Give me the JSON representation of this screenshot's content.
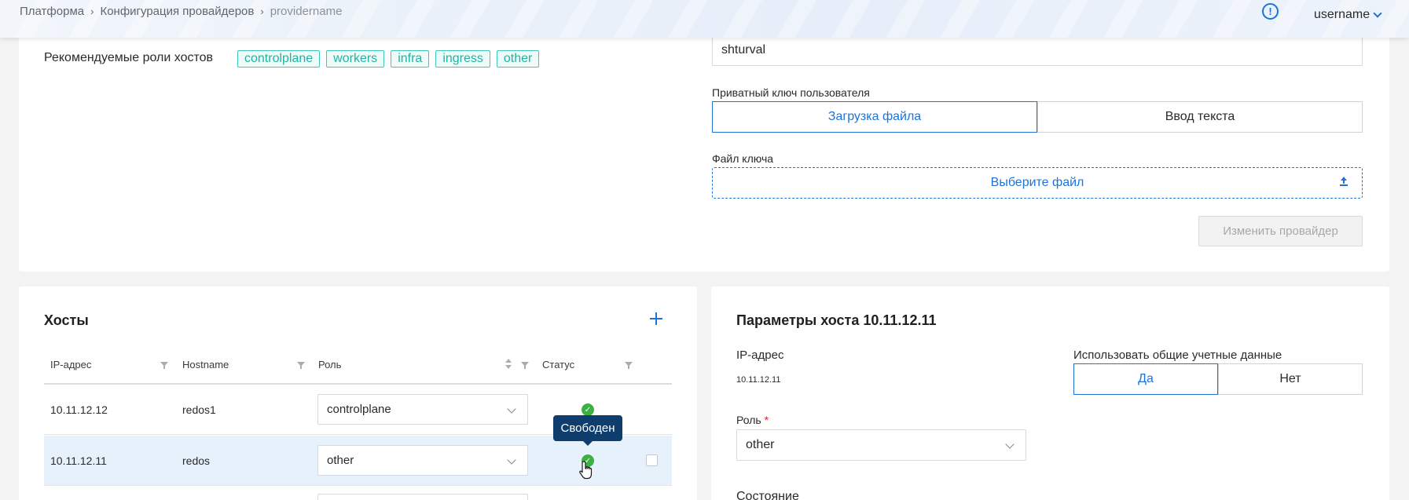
{
  "header": {
    "breadcrumb": [
      "Платформа",
      "Конфигурация провайдеров",
      "providername"
    ],
    "username": "username"
  },
  "provider": {
    "roles_label": "Рекомендуемые роли хостов",
    "roles": [
      "controlplane",
      "workers",
      "infra",
      "ingress",
      "other"
    ],
    "user_value": "shturval",
    "private_key_label": "Приватный ключ пользователя",
    "key_modes": [
      "Загрузка файла",
      "Ввод текста"
    ],
    "key_file_label": "Файл ключа",
    "choose_file": "Выберите файл",
    "submit": "Изменить провайдер"
  },
  "hosts": {
    "title": "Хосты",
    "columns": [
      "IP-адрес",
      "Hostname",
      "Роль",
      "Статус"
    ],
    "rows": [
      {
        "ip": "10.11.12.12",
        "hostname": "redos1",
        "role": "controlplane"
      },
      {
        "ip": "10.11.12.11",
        "hostname": "redos",
        "role": "other"
      }
    ],
    "tooltip": "Свободен"
  },
  "params": {
    "title": "Параметры хоста 10.11.12.11",
    "ip_label": "IP-адрес",
    "ip_value": "10.11.12.11",
    "shared_creds_label": "Использовать общие учетные данные",
    "shared_creds_options": [
      "Да",
      "Нет"
    ],
    "role_label": "Роль",
    "role_required": "*",
    "role_value": "other",
    "state_label": "Состояние"
  },
  "colors": {
    "accent": "#1e73d8",
    "tag": "#21b3a1",
    "status_ok": "#3cb043",
    "tooltip": "#0e3d6e"
  }
}
